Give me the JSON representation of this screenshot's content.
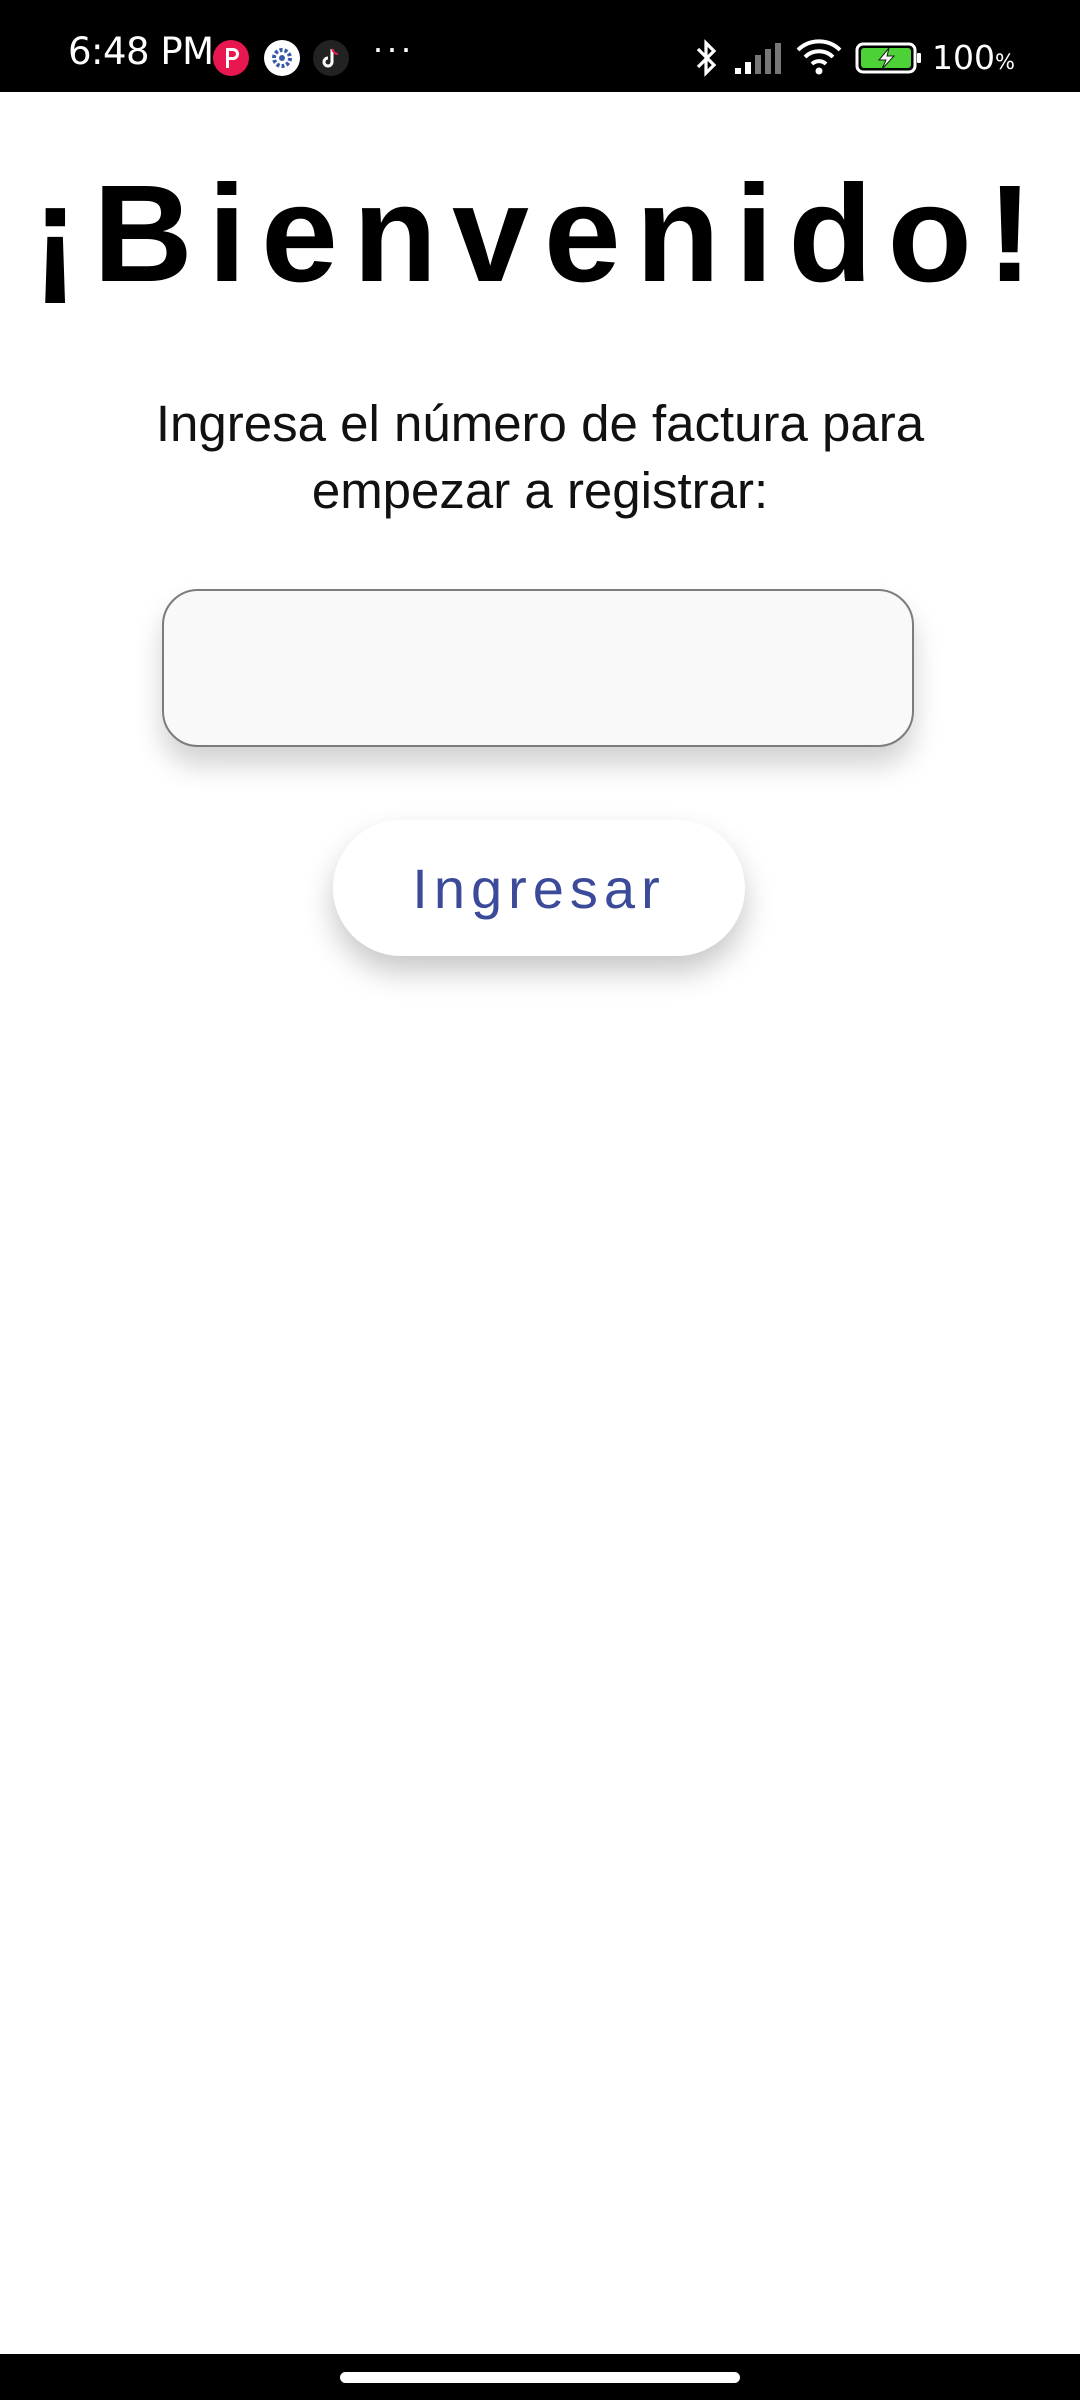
{
  "status_bar": {
    "time": "6:48 PM",
    "battery_percent": "100",
    "battery_unit": "%",
    "notification_icons": [
      "pinterest-like-icon",
      "settings-icon",
      "tiktok-icon"
    ],
    "more_indicator": "···",
    "system_icons": [
      "bluetooth-icon",
      "signal-icon",
      "wifi-icon",
      "battery-charging-icon"
    ]
  },
  "main": {
    "title": "¡Bienvenido!",
    "prompt": "Ingresa el número de factura para empezar a registrar:",
    "invoice_input": {
      "value": "",
      "placeholder": ""
    },
    "submit_label": "Ingresar"
  },
  "colors": {
    "accent_text": "#3b4b9a",
    "background": "#ffffff",
    "status_bar": "#000000"
  }
}
